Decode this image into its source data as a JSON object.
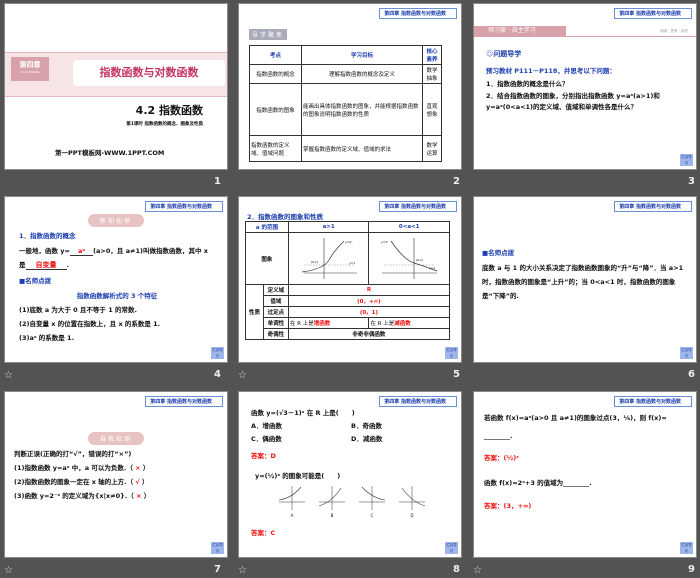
{
  "chapter_tag": "第四章  指数函数与对数函数",
  "back_label": "栏目导引",
  "slides": [
    {
      "num": "1",
      "badge": "第四章",
      "badge_sub": "DI SI ZHANG",
      "title": "指数函数与对数函数",
      "section": "4.2    指数函数",
      "subtitle": "第1课时  指数函数的概念、图象及性质",
      "footer": "第一PPT模板网-WWW.1PPT.COM"
    },
    {
      "num": "2",
      "heading": "导学聚焦",
      "headers": [
        "考点",
        "学习目标",
        "核心素养"
      ],
      "rows": [
        [
          "指数函数的概念",
          "理解指数函数的概念及定义",
          "数学抽象"
        ],
        [
          "指数函数的图象",
          "能画出具体指数函数的图象，并能根据指数函数的图象说明指数函数的性质",
          "直观想象"
        ],
        [
          "指数函数的定义域、值域问题",
          "掌握指数函数的定义域、值域的求法",
          "数学运算"
        ]
      ]
    },
    {
      "num": "3",
      "banner": "预习案 · 自主学习",
      "banner_right": "阅读 · 思考 · 探究",
      "q_title": "问题导学",
      "intro": "预习教材 P111－P118，并思考以下问题：",
      "q1": "1．指数函数的概念是什么？",
      "q2": "2．结合指数函数的图象，分别指出指数函数 y=aˣ(a>1)和 y=aˣ(0<a<1)的定义域、值域和单调性各是什么？"
    },
    {
      "num": "4",
      "pill": "新知初探",
      "h1": "1．指数函数的概念",
      "line1a": "一般地，函数 y=",
      "fill1": "aˣ",
      "line1b": "(a>0，且 a≠1)叫做指数函数，其中 x",
      "line2a": "是",
      "fill2": "自变量",
      "h2": "■名师点拨",
      "h3": "指数函数解析式的 3 个特征",
      "p1": "(1)底数 a 为大于 0 且不等于 1 的常数.",
      "p2": "(2)自变量 x 的位置在指数上，且 x 的系数是 1.",
      "p3": "(3)aˣ 的系数是 1."
    },
    {
      "num": "5",
      "heading": "2．指数函数的图象和性质",
      "col0": "a 的范围",
      "col1": "a>1",
      "col2": "0<a<1",
      "graph_label": "图象",
      "prop_label": "性质",
      "props": [
        "定义域",
        "值域",
        "过定点",
        "单调性",
        "奇偶性"
      ],
      "domain": "R",
      "range": "(0，+∞)",
      "point": "(0，1)",
      "mono_prefix": "在 R 上是",
      "mono1": "增函数",
      "mono2": "减函数",
      "parity": "非奇非偶函数",
      "g_label1": "y=aˣ",
      "g_pt": "(0,1)",
      "g_y1": "y=1",
      "g_o": "O",
      "g_x": "x",
      "g_y": "y"
    },
    {
      "num": "6",
      "h": "■名师点拨",
      "text": "底数 a 与 1 的大小关系决定了指数函数图象的“升”与“降”．当 a>1 时，指数函数的图象是“上升”的；当 0<a<1 时，指数函数的图象是“下降”的."
    },
    {
      "num": "7",
      "pill": "自我检测",
      "intro": "判断正误(正确的打“√”，错误的打“×”)",
      "items": [
        {
          "t": "(1)指数函数 y=aˣ 中，a 可以为负数.（",
          "m": "×"
        },
        {
          "t": "(2)指数函数的图象一定在 x 轴的上方.（",
          "m": "√"
        },
        {
          "t": "(3)函数 y=2⁻ˣ 的定义域为{x|x≠0}.（",
          "m": "×"
        }
      ],
      "close": "）"
    },
    {
      "num": "8",
      "q1": "函数 y=(√3－1)ˣ 在 R 上是(　　)",
      "opts": [
        "A．增函数",
        "B．奇函数",
        "C．偶函数",
        "D．减函数"
      ],
      "a1": "答案：D",
      "q2": "y=(½)ˣ 的图象可能是(　　)",
      "graphs": [
        "A",
        "B",
        "C",
        "D"
      ],
      "a2": "答案：C"
    },
    {
      "num": "9",
      "q1": "若函数 f(x)=aˣ(a>0 且 a≠1)的图象过点(3，⅛)，则 f(x)=",
      "blank": "________.",
      "a1": "答案：(½)ˣ",
      "q2": "函数 f(x)=2ˣ+3 的值域为________.",
      "a2": "答案：(3，+∞)"
    }
  ]
}
